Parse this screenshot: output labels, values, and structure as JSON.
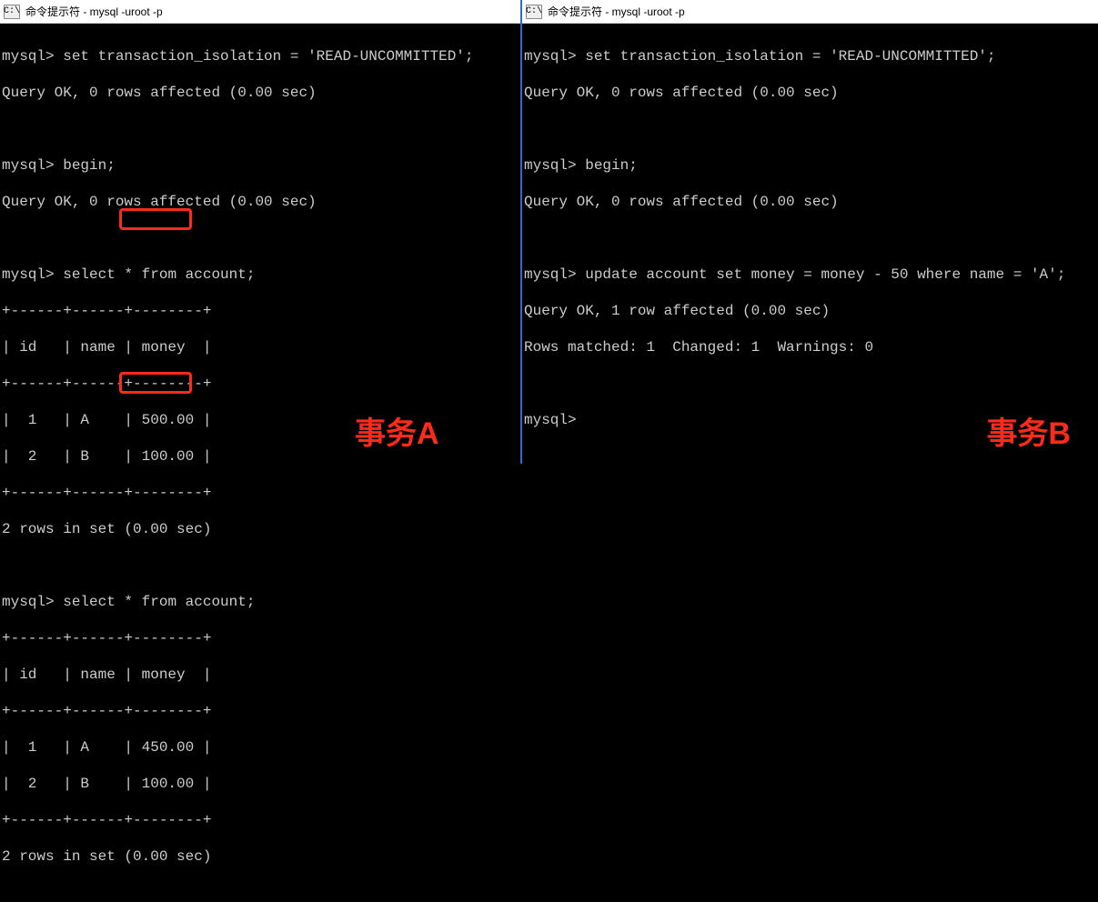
{
  "left": {
    "title": "命令提示符 - mysql  -uroot -p",
    "icon_label": "C:\\",
    "prompt": "mysql>",
    "cmd_set_isolation": "set transaction_isolation = 'READ-UNCOMMITTED';",
    "query_ok_0": "Query OK, 0 rows affected (0.00 sec)",
    "cmd_begin": "begin;",
    "cmd_select": "select * from account;",
    "table_border_top": "+------+------+--------+",
    "table_header": "| id   | name | money  |",
    "table_border_mid": "+------+------+--------+",
    "table1_row1": "|  1   | A    | 500.00 |",
    "table1_row2": "|  2   | B    | 100.00 |",
    "table_border_bot": "+------+------+--------+",
    "rows_in_set": "2 rows in set (0.00 sec)",
    "table2_row1": "|  1   | A    | 450.00 |",
    "table2_row2": "|  2   | B    | 100.00 |",
    "caption": "事务A",
    "highlight1_value": "500.00",
    "highlight2_value": "450.00"
  },
  "right": {
    "title": "命令提示符 - mysql  -uroot -p",
    "icon_label": "C:\\",
    "prompt": "mysql>",
    "cmd_set_isolation": "set transaction_isolation = 'READ-UNCOMMITTED';",
    "query_ok_0": "Query OK, 0 rows affected (0.00 sec)",
    "cmd_begin": "begin;",
    "cmd_update": "update account set money = money - 50 where name = 'A';",
    "query_ok_1": "Query OK, 1 row affected (0.00 sec)",
    "rows_matched": "Rows matched: 1  Changed: 1  Warnings: 0",
    "caption": "事务B"
  }
}
